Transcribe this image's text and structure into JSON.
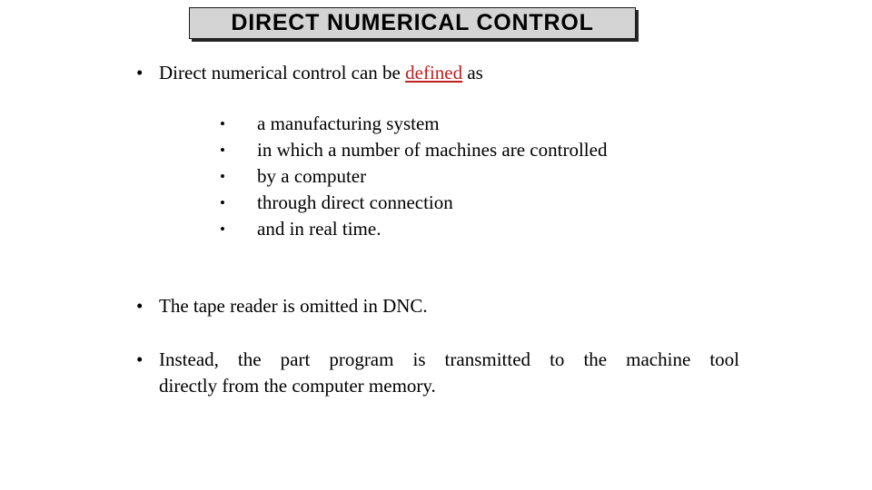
{
  "slide": {
    "title": "DIRECT NUMERICAL CONTROL",
    "colors": {
      "background": "#ffffff",
      "title_fill": "#d4d4d4",
      "title_border": "#1a1a1a",
      "text": "#000000",
      "accent_red": "#bf1f1f"
    },
    "bullets": {
      "marker": "•",
      "sub_marker": "•"
    },
    "intro": {
      "before_link": "Direct numerical control can be ",
      "link": "defined",
      "after_link": " as"
    },
    "definition_items": [
      "a manufacturing system",
      "in which a number of machines are controlled",
      "by a computer",
      "through direct connection",
      "and in real time."
    ],
    "statements": [
      {
        "text": "The tape reader is omitted in DNC."
      }
    ],
    "closing": {
      "line1": "Instead, the part program is transmitted to the machine tool",
      "line2": "directly from the computer memory."
    }
  }
}
